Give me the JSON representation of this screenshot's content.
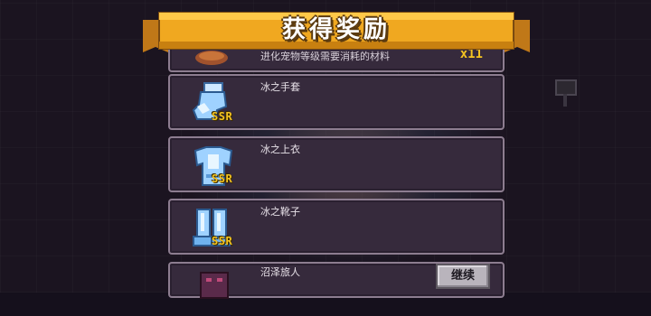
{
  "banner": {
    "title": "获得奖励"
  },
  "rewards": [
    {
      "name": "",
      "description": "进化宠物等级需要消耗的材料",
      "count": "x11",
      "icon": "pet-material-icon"
    },
    {
      "name": "冰之手套",
      "rarity": "SSR",
      "icon": "ice-glove-icon"
    },
    {
      "name": "冰之上衣",
      "rarity": "SSR",
      "icon": "ice-armor-icon"
    },
    {
      "name": "冰之靴子",
      "rarity": "SSR",
      "icon": "ice-boots-icon"
    },
    {
      "name": "沼泽旅人",
      "icon": "swamp-traveler-icon"
    }
  ],
  "continue_button": {
    "label": "继续"
  },
  "colors": {
    "banner": "#f0a820",
    "rarity_ssr": "#f5c421",
    "item_bg": "#362a3c",
    "item_border": "#8d7d90"
  }
}
